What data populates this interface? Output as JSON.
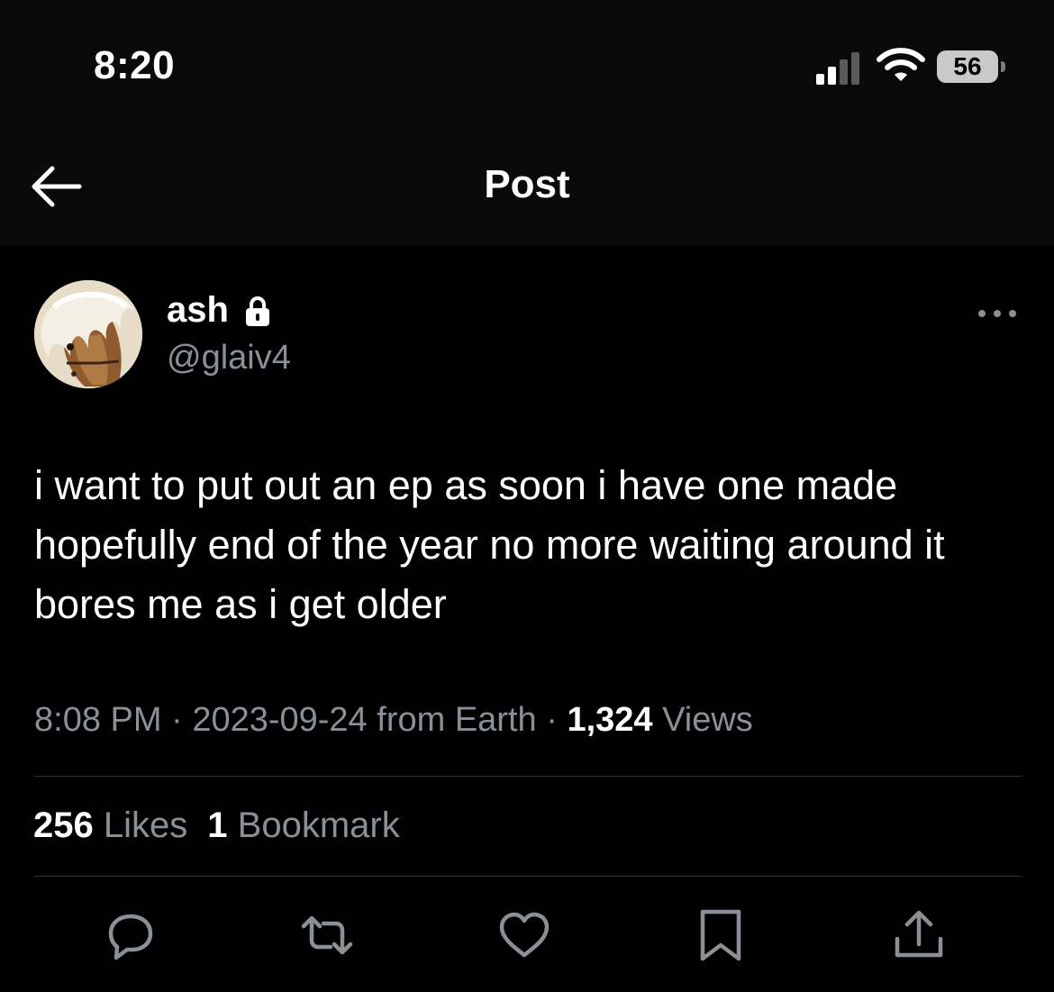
{
  "status_bar": {
    "time": "8:20",
    "battery": "56",
    "icons": [
      "signal-icon",
      "wifi-icon",
      "battery-icon"
    ]
  },
  "header": {
    "title": "Post",
    "back_icon": "back-arrow-icon"
  },
  "post": {
    "display_name": "ash",
    "handle": "@glaiv4",
    "protected_icon": "lock-icon",
    "more_icon": "more-icon",
    "text": "i want to put out an ep as soon i have one made hopefully end of the year no more waiting around it bores me as i get older",
    "time": "8:08 PM",
    "date": "2023-09-24",
    "location": "from Earth",
    "views_count": "1,324",
    "views_label": "Views"
  },
  "stats": {
    "likes_count": "256",
    "likes_label": "Likes",
    "bookmarks_count": "1",
    "bookmarks_label": "Bookmark"
  },
  "actions": [
    "reply-icon",
    "repost-icon",
    "like-icon",
    "bookmark-icon",
    "share-icon"
  ],
  "colors": {
    "background": "#000000",
    "header_background": "#0a0a0a",
    "primary_text": "#ffffff",
    "secondary_text": "#8b9096",
    "divider": "#2f3336"
  }
}
